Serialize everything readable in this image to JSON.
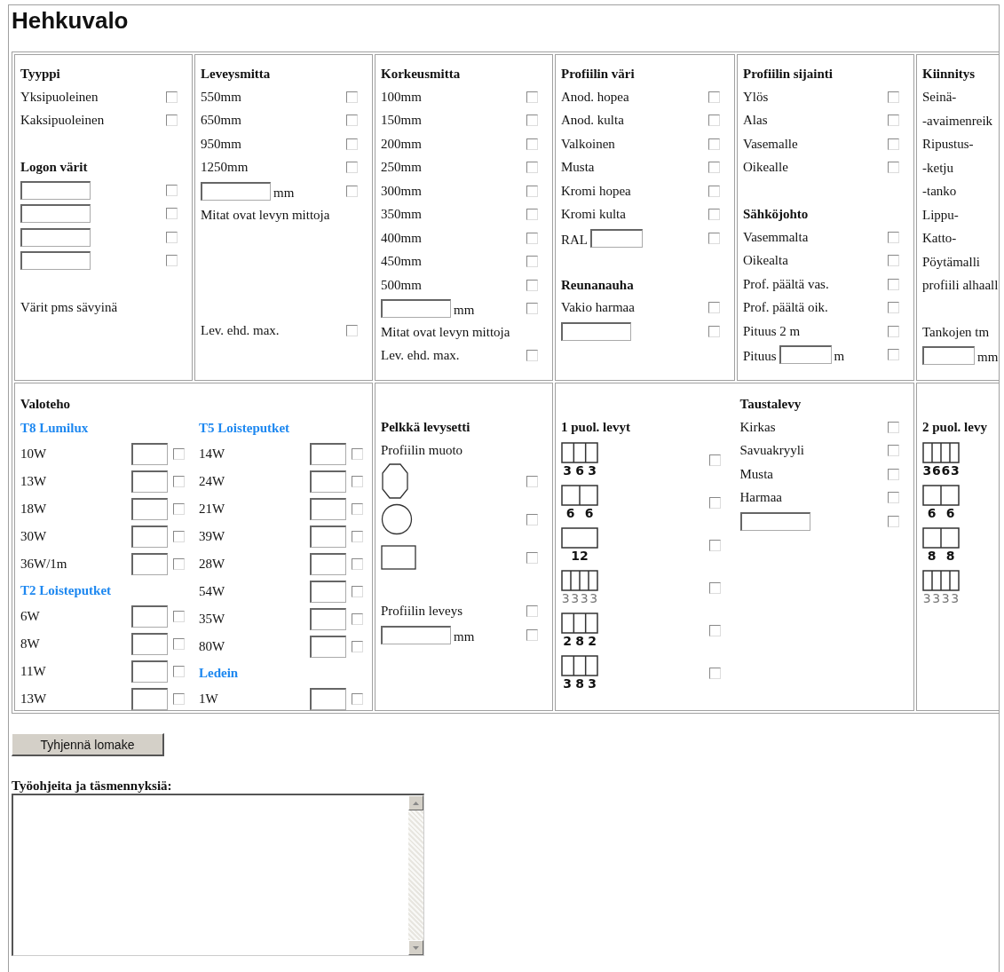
{
  "title": "Hehkuvalo",
  "row1": [
    {
      "columns": [
        [
          {
            "kind": "heading",
            "text": "Tyyppi"
          },
          {
            "kind": "check",
            "label": "Yksipuoleinen",
            "checked": false
          },
          {
            "kind": "check",
            "label": "Kaksipuoleinen",
            "checked": false
          },
          {
            "kind": "spacer"
          },
          {
            "kind": "heading",
            "text": "Logon värit"
          },
          {
            "kind": "field-check",
            "checked": false
          },
          {
            "kind": "field-check",
            "checked": false
          },
          {
            "kind": "field-check",
            "checked": false
          },
          {
            "kind": "field-check",
            "checked": false
          },
          {
            "kind": "spacer"
          },
          {
            "kind": "text",
            "text": "Värit pms sävyinä"
          }
        ]
      ]
    },
    {
      "columns": [
        [
          {
            "kind": "heading",
            "text": "Leveysmitta"
          },
          {
            "kind": "check",
            "label": "550mm",
            "checked": false
          },
          {
            "kind": "check",
            "label": "650mm",
            "checked": false
          },
          {
            "kind": "check",
            "label": "950mm",
            "checked": false
          },
          {
            "kind": "check",
            "label": "1250mm",
            "checked": false
          },
          {
            "kind": "field-check",
            "unit": "mm",
            "checked": false
          },
          {
            "kind": "text",
            "text": "Mitat ovat levyn mittoja"
          },
          {
            "kind": "spacer"
          },
          {
            "kind": "spacer"
          },
          {
            "kind": "spacer"
          },
          {
            "kind": "spacer"
          },
          {
            "kind": "check",
            "label": "Lev. ehd. max.",
            "checked": false
          }
        ]
      ]
    },
    {
      "columns": [
        [
          {
            "kind": "heading",
            "text": "Korkeusmitta"
          },
          {
            "kind": "check",
            "label": "100mm",
            "checked": false
          },
          {
            "kind": "check",
            "label": "150mm",
            "checked": false
          },
          {
            "kind": "check",
            "label": "200mm",
            "checked": false
          },
          {
            "kind": "check",
            "label": "250mm",
            "checked": false
          },
          {
            "kind": "check",
            "label": "300mm",
            "checked": false
          },
          {
            "kind": "check",
            "label": "350mm",
            "checked": false
          },
          {
            "kind": "check",
            "label": "400mm",
            "checked": false
          },
          {
            "kind": "check",
            "label": "450mm",
            "checked": false
          },
          {
            "kind": "check",
            "label": "500mm",
            "checked": false
          },
          {
            "kind": "field-check",
            "unit": "mm",
            "checked": false
          },
          {
            "kind": "text",
            "text": "Mitat ovat levyn mittoja"
          },
          {
            "kind": "check",
            "label": "Lev. ehd. max.",
            "checked": false
          }
        ]
      ]
    },
    {
      "columns": [
        [
          {
            "kind": "heading",
            "text": "Profiilin väri"
          },
          {
            "kind": "check",
            "label": "Anod. hopea",
            "checked": false
          },
          {
            "kind": "check",
            "label": "Anod. kulta",
            "checked": false
          },
          {
            "kind": "check",
            "label": "Valkoinen",
            "checked": false
          },
          {
            "kind": "check",
            "label": "Musta",
            "checked": false
          },
          {
            "kind": "check",
            "label": "Kromi hopea",
            "checked": false
          },
          {
            "kind": "check",
            "label": "Kromi kulta",
            "checked": false
          },
          {
            "kind": "field-check",
            "prefix": "RAL",
            "checked": false
          },
          {
            "kind": "spacer"
          },
          {
            "kind": "heading",
            "text": "Reunanauha"
          },
          {
            "kind": "check",
            "label": "Vakio harmaa",
            "checked": false
          },
          {
            "kind": "field-check",
            "checked": false
          }
        ]
      ]
    },
    {
      "columns": [
        [
          {
            "kind": "heading",
            "text": "Profiilin sijainti"
          },
          {
            "kind": "check",
            "label": "Ylös",
            "checked": false
          },
          {
            "kind": "check",
            "label": "Alas",
            "checked": false
          },
          {
            "kind": "check",
            "label": "Vasemalle",
            "checked": false
          },
          {
            "kind": "check",
            "label": "Oikealle",
            "checked": false
          },
          {
            "kind": "spacer"
          },
          {
            "kind": "heading",
            "text": "Sähköjohto"
          },
          {
            "kind": "check",
            "label": "Vasemmalta",
            "checked": false
          },
          {
            "kind": "check",
            "label": "Oikealta",
            "checked": false
          },
          {
            "kind": "check",
            "label": "Prof. päältä vas.",
            "checked": false
          },
          {
            "kind": "check",
            "label": "Prof. päältä oik.",
            "checked": false
          },
          {
            "kind": "check",
            "label": "Pituus 2 m",
            "checked": false
          },
          {
            "kind": "field-check",
            "prefix": "Pituus",
            "unit": "m",
            "checked": false
          }
        ]
      ]
    },
    {
      "columns": [
        [
          {
            "kind": "heading",
            "text": "Kiinnitys"
          },
          {
            "kind": "text",
            "text": "Seinä-"
          },
          {
            "kind": "text",
            "text": "-avaimenreik"
          },
          {
            "kind": "text",
            "text": "Ripustus-"
          },
          {
            "kind": "text",
            "text": "-ketju"
          },
          {
            "kind": "text",
            "text": "-tanko"
          },
          {
            "kind": "text",
            "text": "Lippu-"
          },
          {
            "kind": "text",
            "text": "Katto-"
          },
          {
            "kind": "text",
            "text": "Pöytämalli"
          },
          {
            "kind": "text",
            "text": "profiili alhaall"
          },
          {
            "kind": "spacer"
          },
          {
            "kind": "text",
            "text": "Tankojen tm"
          },
          {
            "kind": "field",
            "unit": "mm"
          }
        ]
      ]
    }
  ],
  "row2": [
    {
      "heading": "Valoteho",
      "columns": [
        [
          {
            "kind": "subheading",
            "text": "T8 Lumilux"
          },
          {
            "kind": "qty-check",
            "label": "10W",
            "checked": false
          },
          {
            "kind": "qty-check",
            "label": "13W",
            "checked": false
          },
          {
            "kind": "qty-check",
            "label": "18W",
            "checked": false
          },
          {
            "kind": "qty-check",
            "label": "30W",
            "checked": false
          },
          {
            "kind": "qty-check",
            "label": "36W/1m",
            "checked": false
          },
          {
            "kind": "subheading",
            "text": "T2 Loisteputket"
          },
          {
            "kind": "qty-check",
            "label": "6W",
            "checked": false
          },
          {
            "kind": "qty-check",
            "label": "8W",
            "checked": false
          },
          {
            "kind": "qty-check",
            "label": "11W",
            "checked": false
          },
          {
            "kind": "qty-check",
            "label": "13W",
            "checked": false
          }
        ],
        [
          {
            "kind": "subheading",
            "text": "T5 Loisteputket"
          },
          {
            "kind": "qty-check",
            "label": "14W",
            "checked": false
          },
          {
            "kind": "qty-check",
            "label": "24W",
            "checked": false
          },
          {
            "kind": "qty-check",
            "label": "21W",
            "checked": false
          },
          {
            "kind": "qty-check",
            "label": "39W",
            "checked": false
          },
          {
            "kind": "qty-check",
            "label": "28W",
            "checked": false
          },
          {
            "kind": "qty-check",
            "label": "54W",
            "checked": false
          },
          {
            "kind": "qty-check",
            "label": "35W",
            "checked": false
          },
          {
            "kind": "qty-check",
            "label": "80W",
            "checked": false
          },
          {
            "kind": "subheading",
            "text": "Ledein"
          },
          {
            "kind": "qty-check",
            "label": "1W",
            "checked": false
          }
        ]
      ]
    },
    {
      "columns": [
        [
          {
            "kind": "spacer"
          },
          {
            "kind": "heading",
            "text": "Pelkkä levysetti"
          },
          {
            "kind": "text",
            "text": "Profiilin muoto"
          },
          {
            "kind": "octagon",
            "checked": false
          },
          {
            "kind": "circle",
            "checked": false
          },
          {
            "kind": "rectangle",
            "checked": false
          },
          {
            "kind": "spacer"
          },
          {
            "kind": "check",
            "label": "Profiilin leveys",
            "checked": false
          },
          {
            "kind": "field-check",
            "unit": "mm",
            "checked": false
          }
        ]
      ]
    },
    {
      "columns": [
        [
          {
            "kind": "spacer"
          },
          {
            "kind": "heading",
            "text": "1 puol. levyt"
          },
          {
            "kind": "panel-check",
            "segments": [
              "3",
              "6",
              "3"
            ],
            "faint": false,
            "checked": false
          },
          {
            "kind": "panel-check",
            "segments": [
              "6",
              "6"
            ],
            "faint": false,
            "checked": false
          },
          {
            "kind": "panel-check",
            "segments": [
              "12"
            ],
            "faint": false,
            "checked": false
          },
          {
            "kind": "panel-check",
            "segments": [
              "3",
              "3",
              "3",
              "3"
            ],
            "faint": true,
            "checked": false
          },
          {
            "kind": "panel-check",
            "segments": [
              "2",
              "8",
              "2"
            ],
            "faint": false,
            "checked": false
          },
          {
            "kind": "panel-check",
            "segments": [
              "3",
              "8",
              "3"
            ],
            "faint": false,
            "checked": false
          }
        ],
        [
          {
            "kind": "heading",
            "text": "Taustalevy"
          },
          {
            "kind": "check",
            "label": "Kirkas",
            "checked": false
          },
          {
            "kind": "check",
            "label": "Savuakryyli",
            "checked": false
          },
          {
            "kind": "check",
            "label": "Musta",
            "checked": false
          },
          {
            "kind": "check",
            "label": "Harmaa",
            "checked": false
          },
          {
            "kind": "field-check",
            "checked": false
          }
        ]
      ]
    },
    {
      "columns": [
        [
          {
            "kind": "spacer"
          },
          {
            "kind": "heading",
            "text": "2 puol. levy"
          },
          {
            "kind": "panel",
            "segments": [
              "3",
              "6",
              "6",
              "3"
            ],
            "faint": false
          },
          {
            "kind": "panel",
            "segments": [
              "6",
              "6"
            ],
            "faint": false
          },
          {
            "kind": "panel",
            "segments": [
              "8",
              "8"
            ],
            "faint": false
          },
          {
            "kind": "panel",
            "segments": [
              "3",
              "3",
              "3",
              "3"
            ],
            "faint": true
          }
        ]
      ]
    }
  ],
  "clear_button": "Tyhjennä lomake",
  "notes": {
    "label": "Työohjeita ja täsmennyksiä:"
  }
}
